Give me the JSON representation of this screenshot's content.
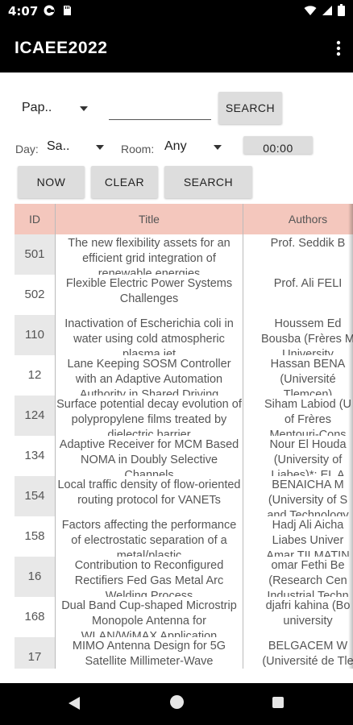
{
  "status_bar": {
    "time": "4:07",
    "icons": [
      "pocket-casts-icon",
      "sd-card-icon",
      "wifi-icon",
      "signal-icon",
      "battery-icon"
    ]
  },
  "app_bar": {
    "title": "ICAEE2022",
    "menu_icon": "more-vert-icon"
  },
  "filters": {
    "type_dropdown": "Pap..",
    "search_input": "",
    "search_button": "SEARCH",
    "day_label": "Day:",
    "day_dropdown": "Sa..",
    "room_label": "Room:",
    "room_dropdown": "Any",
    "time_button": "00:00"
  },
  "actions": {
    "now": "NOW",
    "clear": "CLEAR",
    "search": "SEARCH"
  },
  "table": {
    "header_color": "#f4c7bd",
    "columns": [
      "ID",
      "Title",
      "Authors"
    ],
    "rows": [
      {
        "id": "501",
        "title": "The new flexibility assets for an efficient grid integration of renewable energies",
        "authors": "Prof. Seddik B"
      },
      {
        "id": "502",
        "title": "Flexible Electric Power Systems Challenges",
        "authors": "Prof. Ali FELI"
      },
      {
        "id": "110",
        "title": "Inactivation of Escherichia coli in water using cold atmospheric plasma jet",
        "authors": "Houssem Ed\nBousba (Frères M\nUniversity"
      },
      {
        "id": "12",
        "title": "Lane Keeping SOSM Controller with an Adaptive Automation Authority in Shared Driving",
        "authors": "Hassan BENA\n(Université\nTlemcen)"
      },
      {
        "id": "124",
        "title": "Surface potential decay evolution of polypropylene films treated by dielectric barrier",
        "authors": "Siham Labiod (U\nof Frères\nMentouri-Cons"
      },
      {
        "id": "134",
        "title": "Adaptive Receiver for MCM Based NOMA in Doubly Selective Channels",
        "authors": "Nour El Houda\n(University of\nLiabes)*; EL A"
      },
      {
        "id": "154",
        "title": "Local traffic density of flow-oriented routing protocol for VANETs",
        "authors": "BENAICHA M\n(University of S\nand Technology"
      },
      {
        "id": "158",
        "title": "Factors affecting the performance of electrostatic separation of a metal/plastic",
        "authors": "Hadj Ali Aicha\nLiabes Univer\nAmar TILMATIN"
      },
      {
        "id": "16",
        "title": "Contribution to Reconfigured Rectifiers Fed Gas Metal Arc Welding Process",
        "authors": "omar Fethi Be\n(Research Cen\nIndustrial Techn"
      },
      {
        "id": "168",
        "title": "Dual Band Cup-shaped Microstrip Monopole Antenna for WLAN/WiMAX Application",
        "authors": "djafri kahina (Bo\nuniversity"
      },
      {
        "id": "17",
        "title": "MIMO Antenna Design for 5G Satellite Millimeter-Wave",
        "authors": "BELGACEM W\n(Université de Tle"
      }
    ]
  },
  "nav_bar": {
    "icons": [
      "back-icon",
      "home-icon",
      "recents-icon"
    ]
  }
}
